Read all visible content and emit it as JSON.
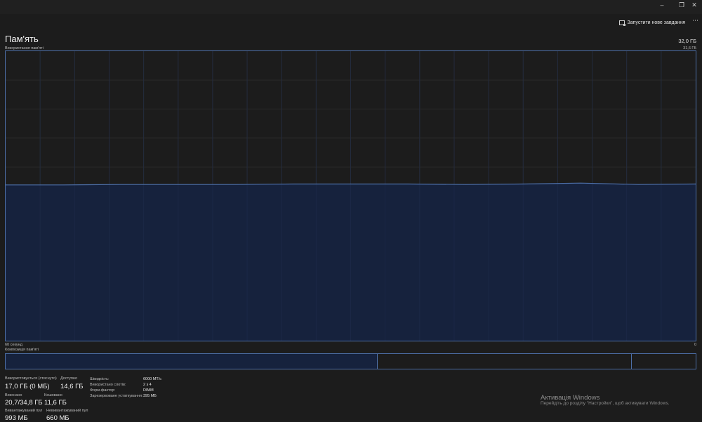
{
  "window": {
    "minimize_icon": "minimize-icon",
    "maximize_icon": "maximize-icon",
    "close_icon": "close-icon"
  },
  "toolbar": {
    "run_task_label": "Запустити нове завдання",
    "more_icon": "more-icon"
  },
  "header": {
    "title": "Пам'ять",
    "total": "32,0 ГБ"
  },
  "usage_chart": {
    "label": "Використання пам'яті",
    "max_label": "31,6 ГБ",
    "time_left": "60 секунд",
    "time_right": "0",
    "line_color": "#4d6fa8",
    "fill_color": "#16223d"
  },
  "chart_data": {
    "type": "area",
    "title": "",
    "xlabel": "",
    "ylabel": "",
    "x": [
      60,
      55,
      50,
      45,
      40,
      35,
      30,
      25,
      20,
      15,
      10,
      5,
      0
    ],
    "values": [
      17.0,
      17.0,
      17.05,
      17.05,
      17.05,
      17.1,
      17.1,
      17.1,
      17.05,
      17.1,
      17.2,
      17.05,
      17.1
    ],
    "ylim": [
      0,
      31.6
    ],
    "xlim": [
      60,
      0
    ],
    "grid": true
  },
  "composition": {
    "label": "Композиція пам'яті",
    "used_fraction": 0.538,
    "modified_fraction": 0.368,
    "standby_fraction": 0.094
  },
  "stats": {
    "in_use_label": "Використовується (стиснуто)",
    "in_use_value": "17,0 ГБ (0 МБ)",
    "available_label": "Доступно",
    "available_value": "14,6 ГБ",
    "committed_label": "Виконано",
    "committed_value": "20,7/34,8 ГБ",
    "cached_label": "Кешовано",
    "cached_value": "11,6 ГБ",
    "paged_pool_label": "Вивантажуваний пул",
    "paged_pool_value": "993 МБ",
    "nonpaged_pool_label": "Невивантажуваний пул",
    "nonpaged_pool_value": "660 МБ"
  },
  "details": {
    "speed_label": "Швидкість:",
    "speed_value": "6000 MT/с",
    "slots_label": "Використано слотів:",
    "slots_value": "2 з 4",
    "form_label": "Форм-фактор:",
    "form_value": "DIMM",
    "reserved_label": "Зарезервоване устаткування:",
    "reserved_value": "395 МБ"
  },
  "watermark": {
    "title": "Активація Windows",
    "text": "Перейдіть до розділу \"Настройки\", щоб активувати Windows."
  }
}
